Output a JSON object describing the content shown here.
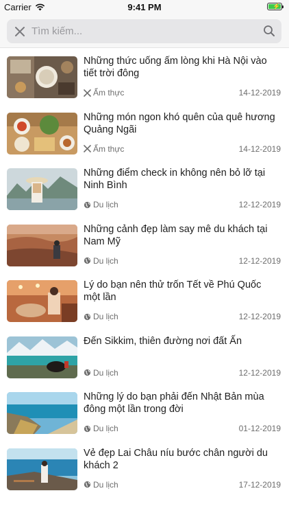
{
  "status_bar": {
    "carrier": "Carrier",
    "time": "9:41 PM"
  },
  "search": {
    "placeholder": "Tìm kiếm..."
  },
  "articles": [
    {
      "title": "Những thức uống ấm lòng khi Hà Nội vào tiết trời đông",
      "category": "Ẩm thực",
      "category_icon": "utensils-icon",
      "date": "14-12-2019"
    },
    {
      "title": "Những món ngon khó quên của quê hương Quảng Ngãi",
      "category": "Ẩm thực",
      "category_icon": "utensils-icon",
      "date": "14-12-2019"
    },
    {
      "title": "Những điểm check in không nên bỏ lỡ tại Ninh Bình",
      "category": "Du lịch",
      "category_icon": "globe-icon",
      "date": "12-12-2019"
    },
    {
      "title": "Những cảnh đẹp làm say mê du khách tại Nam Mỹ",
      "category": "Du lịch",
      "category_icon": "globe-icon",
      "date": "12-12-2019"
    },
    {
      "title": "Lý do bạn nên thử trốn Tết về Phú Quốc một lần",
      "category": "Du lịch",
      "category_icon": "globe-icon",
      "date": "12-12-2019"
    },
    {
      "title": "Đến Sikkim, thiên đường nơi đất Ấn",
      "category": "Du lịch",
      "category_icon": "globe-icon",
      "date": "12-12-2019"
    },
    {
      "title": "Những lý do bạn phải đến Nhật Bản mùa đông một lần trong đời",
      "category": "Du lịch",
      "category_icon": "globe-icon",
      "date": "01-12-2019"
    },
    {
      "title": "Vẻ đẹp Lai Châu níu bước chân người du khách 2",
      "category": "Du lịch",
      "category_icon": "globe-icon",
      "date": "17-12-2019"
    }
  ],
  "colors": {
    "header_bg": "#f7f7f7",
    "search_bg": "#e6e6e8",
    "battery": "#3ec94b",
    "meta_text": "#6d6d6d"
  }
}
